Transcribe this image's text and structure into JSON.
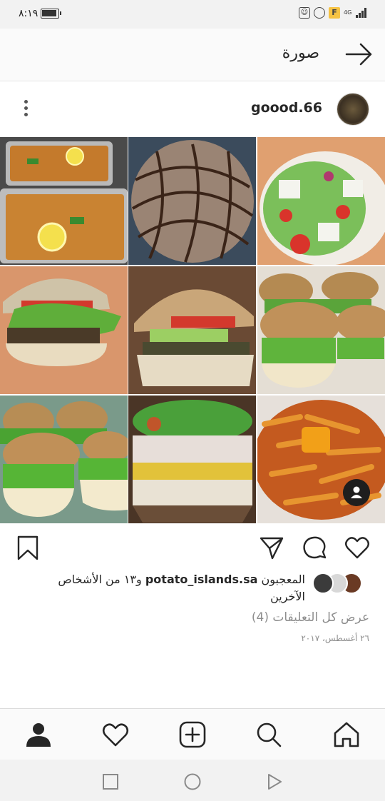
{
  "status_bar": {
    "time": "٨:١٩",
    "icons": [
      "battery-icon",
      "app-icon",
      "whatsapp-icon",
      "f-badge-icon",
      "network-4g-icon",
      "signal-icon"
    ],
    "badge_letter": "F",
    "network": "4G"
  },
  "header": {
    "title": "صورة",
    "back_icon": "arrow-right-icon"
  },
  "post": {
    "username": "goood.66",
    "menu_icon": "kebab-menu-icon"
  },
  "likes": {
    "prefix": "المعجبون",
    "liker": "potato_islands.sa",
    "suffix": "و١٣ من الأشخاص الآخرين"
  },
  "comments_link": "عرض كل التعليقات (4)",
  "date": "٢٦ أغسطس، ٢٠١٧",
  "actions": {
    "like": "heart-icon",
    "comment": "comment-icon",
    "share": "send-icon",
    "save": "bookmark-icon"
  },
  "tabs": [
    "home-icon",
    "search-icon",
    "add-post-icon",
    "activity-heart-icon",
    "profile-icon"
  ],
  "nav": [
    "back-triangle-icon",
    "home-circle-icon",
    "recents-square-icon"
  ],
  "colors": {
    "text": "#262626",
    "secondary": "#8e8e8e",
    "bar_bg": "#fafafa"
  }
}
